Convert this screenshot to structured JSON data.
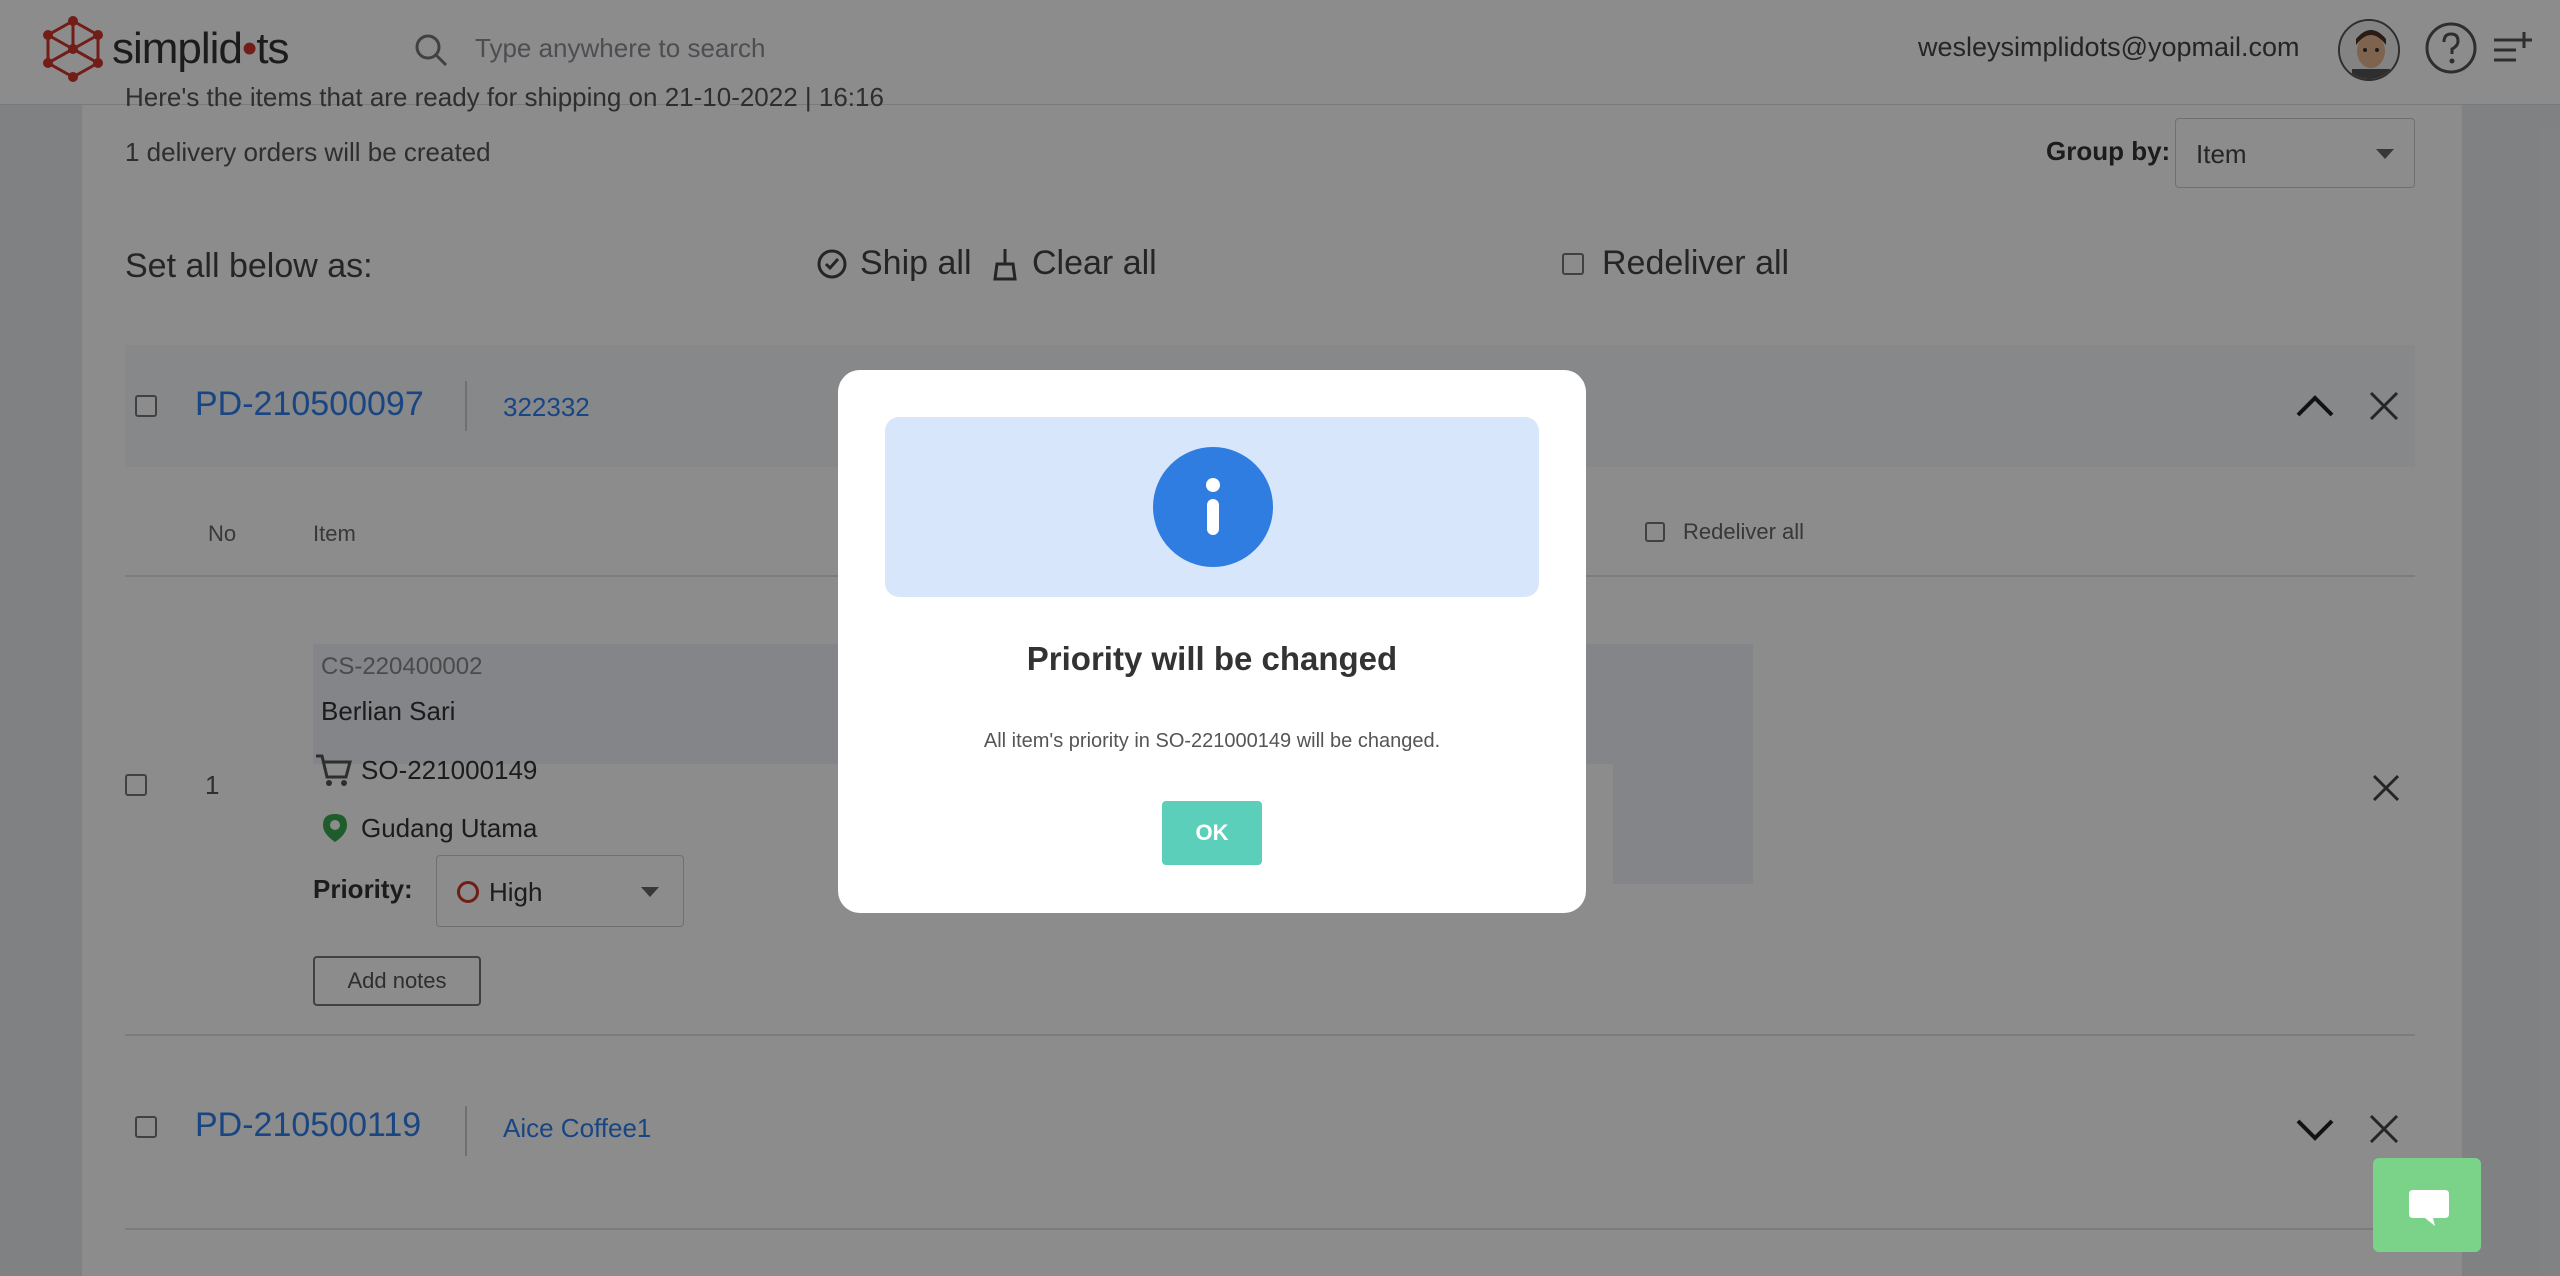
{
  "header": {
    "logo_text_a": "simplid",
    "logo_text_dot": "•",
    "logo_text_b": "ts",
    "search_placeholder": "Type anywhere to search",
    "user_email": "wesleysimplidots@yopmail.com"
  },
  "page": {
    "ready_text": "Here's the items that are ready for shipping on 21-10-2022 | 16:16",
    "orders_count": "1 delivery orders will be created",
    "groupby_label": "Group by:",
    "groupby_value": "Item",
    "setall_label": "Set all below as:",
    "ship_all": "Ship all",
    "clear_all": "Clear all",
    "redeliver_all": "Redeliver all"
  },
  "groups": [
    {
      "id": "PD-210500097",
      "code": "322332",
      "columns": {
        "no": "No",
        "item": "Item",
        "redeliver_all": "Redeliver all"
      },
      "rows": [
        {
          "no": "1",
          "customer_code": "CS-220400002",
          "customer_name": "Berlian Sari",
          "so_number": "SO-221000149",
          "warehouse": "Gudang Utama",
          "priority_label": "Priority:",
          "priority_value": "High",
          "add_notes": "Add notes"
        }
      ]
    },
    {
      "id": "PD-210500119",
      "name": "Aice Coffee1"
    }
  ],
  "modal": {
    "title": "Priority will be changed",
    "message": "All item's priority in SO-221000149 will be changed.",
    "ok_label": "OK"
  },
  "colors": {
    "brand_red": "#d0362d",
    "link_blue": "#2f80ed",
    "info_blue": "#2f7de1",
    "ok_teal": "#5ccfbb",
    "chat_green": "#7bd389"
  }
}
